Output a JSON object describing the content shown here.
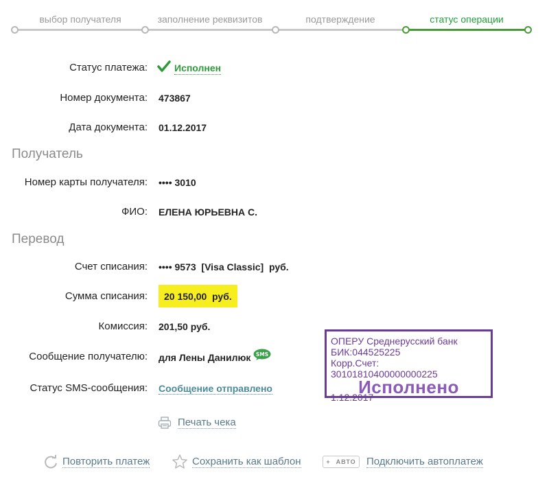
{
  "stepper": {
    "steps": [
      {
        "label": "выбор получателя",
        "active": false
      },
      {
        "label": "заполнение реквизитов",
        "active": false
      },
      {
        "label": "подтверждение",
        "active": false
      },
      {
        "label": "статус операции",
        "active": true
      }
    ]
  },
  "payment": {
    "status_label": "Статус платежа:",
    "status_value": "Исполнен",
    "doc_number_label": "Номер документа:",
    "doc_number_value": "473867",
    "doc_date_label": "Дата документа:",
    "doc_date_value": "01.12.2017"
  },
  "recipient": {
    "section_title": "Получатель",
    "card_label": "Номер карты получателя:",
    "card_value": "•••• 3010",
    "name_label": "ФИО:",
    "name_value": "ЕЛЕНА ЮРЬЕВНА С."
  },
  "transfer": {
    "section_title": "Перевод",
    "account_label": "Счет списания:",
    "account_value": "•••• 9573  [Visa Classic]  руб.",
    "amount_label": "Сумма списания:",
    "amount_value": "20 150,00  руб.",
    "commission_label": "Комиссия:",
    "commission_value": "201,50 руб.",
    "message_label": "Сообщение получателю:",
    "message_value": "для Лены Данилюк",
    "sms_badge": "SMS",
    "sms_status_label": "Статус SMS-сообщения:",
    "sms_status_value": "Сообщение отправлено"
  },
  "stamp": {
    "line1": "ОПЕРУ Среднерусский банк",
    "line2": "БИК:044525225",
    "line3": "Корр.Счет: 30101810400000000225",
    "big": "Исполнено",
    "date": "1.12.2017"
  },
  "actions": {
    "print": "Печать чека",
    "repeat": "Повторить платеж",
    "save_template": "Сохранить как шаблон",
    "auto_badge_plus": "+",
    "auto_badge_text": "АВТО",
    "autopay": "Подключить автоплатеж"
  },
  "colors": {
    "accent_green": "#21a038",
    "highlight_yellow": "#f7ee1f",
    "stamp_purple": "#6a3a9a"
  }
}
